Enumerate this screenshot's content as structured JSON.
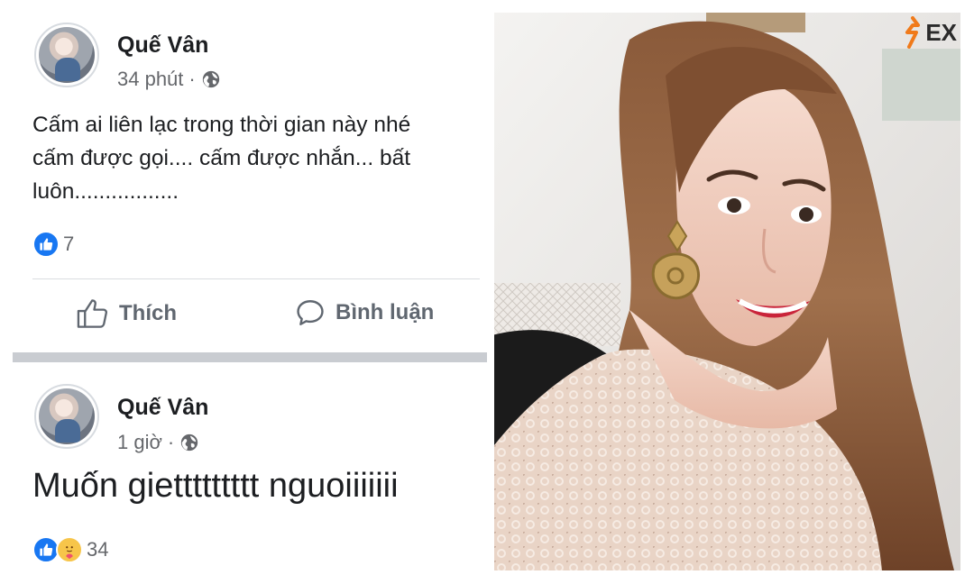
{
  "post1": {
    "author": "Quế Vân",
    "time": "34 phút",
    "separator": "·",
    "text_line1": "Cấm ai liên lạc trong thời gian này nhé",
    "text_line2": "cấm được gọi.... cấm được nhắn... bất",
    "text_line3": "luôn.................",
    "reaction_count": "7",
    "actions": {
      "like": "Thích",
      "comment": "Bình luận"
    }
  },
  "post2": {
    "author": "Quế Vân",
    "time": "1 giờ",
    "separator": "·",
    "text": "Muốn giettttttttt nguoiiiiiii",
    "reaction_count": "34"
  },
  "photo": {
    "watermark": "EX",
    "icons": [
      "globe-icon",
      "like-icon",
      "care-icon",
      "comment-icon"
    ]
  },
  "colors": {
    "facebook_blue": "#1877f2",
    "text_primary": "#1c1e21",
    "text_secondary": "#65676b",
    "care_yellow": "#f7c54a",
    "watermark_orange": "#f07a1a"
  }
}
